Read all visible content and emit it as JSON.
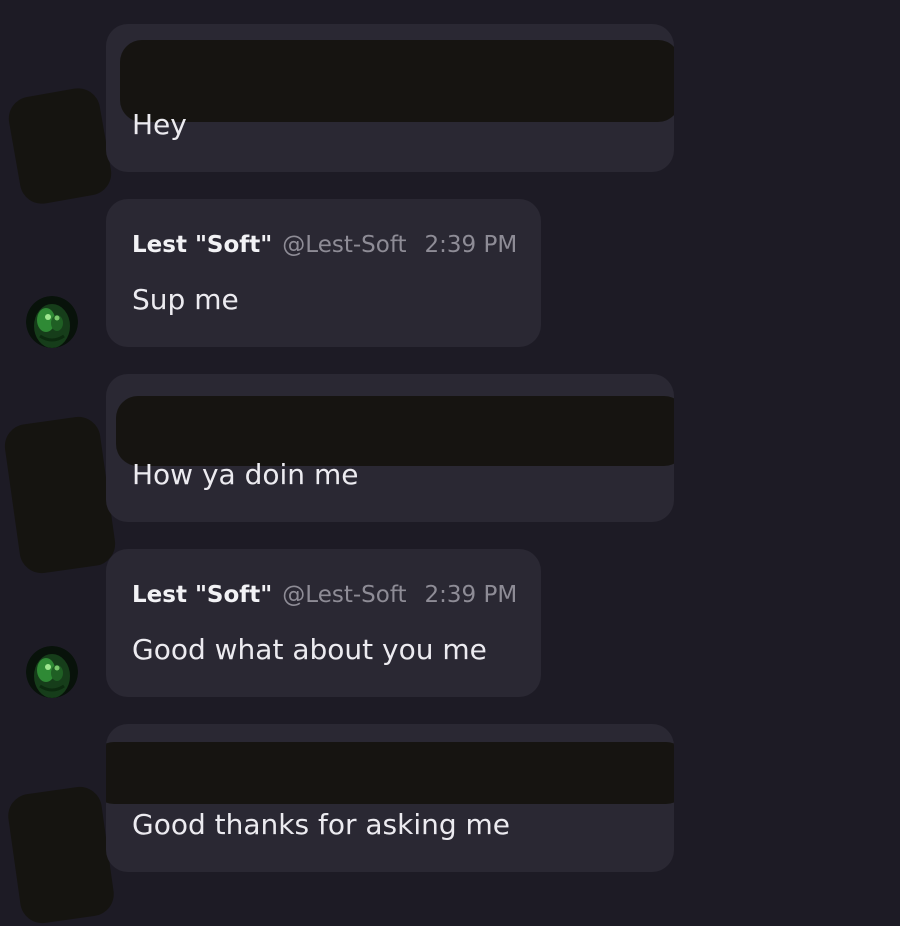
{
  "messages": [
    {
      "text": "Hey"
    },
    {
      "author": "Lest \"Soft\"",
      "handle": "@Lest-Soft",
      "time": "2:39 PM",
      "text": "Sup me"
    },
    {
      "text": "How ya doin me"
    },
    {
      "author": "Lest \"Soft\"",
      "handle": "@Lest-Soft",
      "time": "2:39 PM",
      "text": "Good what about you me"
    },
    {
      "text": "Good thanks for asking me"
    }
  ],
  "colors": {
    "background": "#1d1b25",
    "bubble": "#2a2833",
    "author_text": "#f2f2f5",
    "muted_text": "#8e8c96",
    "message_text": "#ecebf0"
  },
  "icons": {
    "avatar": "lest-soft-avatar-icon"
  }
}
